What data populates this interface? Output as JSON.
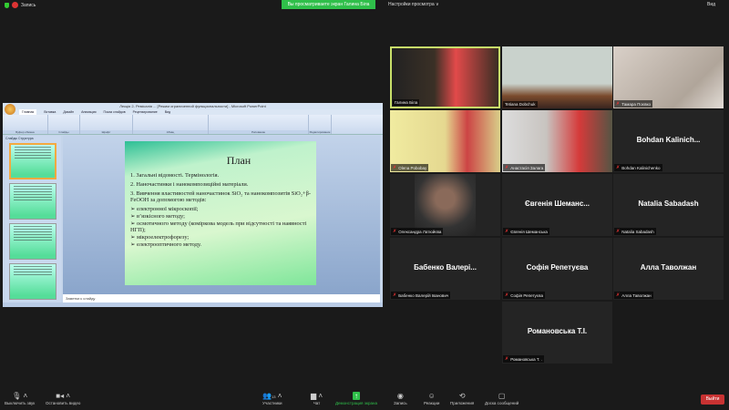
{
  "topbar": {
    "recording": "Запись",
    "viewing": "Вы просматриваете экран Галина Біла",
    "view_options": "Настройки просмотра ∨",
    "view_mode": "Вид"
  },
  "ppt": {
    "title": "Лекція 2- Ремісалія ... [Режим ограниченной функциональности] - Microsoft PowerPoint",
    "tabs": [
      "Главная",
      "Вставка",
      "Дизайн",
      "Анимация",
      "Показ слайдов",
      "Рецензирование",
      "Вид"
    ],
    "groups": [
      "Буфер обмена",
      "Слайды",
      "Шрифт",
      "Абзац",
      "Рисование",
      "Редактирование"
    ],
    "pane_tabs": [
      "Слайды",
      "Структура"
    ],
    "notes": "Заметки к слайду",
    "slide": {
      "title": "План",
      "items": [
        "1. Загальні відомості. Термінологія.",
        "2. Наночастинки і нанокомпозиційні матеріали.",
        "3. Вивчення властивостей наночастинок SiO₂ та нанокомпозитів SiO₂+β-FeOOH за допомогою методів:"
      ],
      "bullets": [
        "➢ електронної мікроскопії;",
        "➢ в’язкісного методу;",
        "➢ осмотичного методу (коміркова модель при відсутності та наявності НГП);",
        "➢ мікроелектрофорезу;",
        "➢ електрооптичного методу."
      ]
    }
  },
  "participants": [
    {
      "tag": "Галина Біла",
      "video": true,
      "active": true,
      "muted": false
    },
    {
      "tag": "Tetiana Dobchuk",
      "video": true,
      "muted": false
    },
    {
      "tag": "Тамара Поєвко",
      "video": true,
      "muted": true
    },
    {
      "tag": "Olena Pobobay",
      "video": true,
      "muted": true
    },
    {
      "tag": "Анастасія Залага",
      "video": true,
      "muted": true
    },
    {
      "name": "Bohdan  Kalinich...",
      "tag": "Bohdan Kalinichenko",
      "muted": true
    },
    {
      "tag": "Олександра Латюйєва",
      "video": true,
      "muted": true
    },
    {
      "name": "Євгенія  Шеманс...",
      "tag": "Євгенія Шеманська",
      "muted": true
    },
    {
      "name": "Natalia Sabadash",
      "tag": "Natalia Sabadash",
      "muted": true
    },
    {
      "name": "Бабенко  Валері...",
      "tag": "Бабенко Валерій Іванович",
      "muted": true
    },
    {
      "name": "Софія Репетуєва",
      "tag": "Софія Репетуєва",
      "muted": true
    },
    {
      "name": "Алла Таволжан",
      "tag": "Алла Таволжан",
      "muted": true
    },
    {
      "name": "Романовська Т.І.",
      "tag": "Романовська Т. .",
      "muted": true
    }
  ],
  "toolbar": {
    "mute": "Выключить звук",
    "video": "Остановить видео",
    "participants": "Участники",
    "participants_count": "13",
    "chat": "Чат",
    "share": "Демонстрация экрана",
    "record": "Запись",
    "reactions": "Реакции",
    "apps": "Приложения",
    "whiteboard": "Доска сообщений",
    "leave": "Выйти"
  }
}
